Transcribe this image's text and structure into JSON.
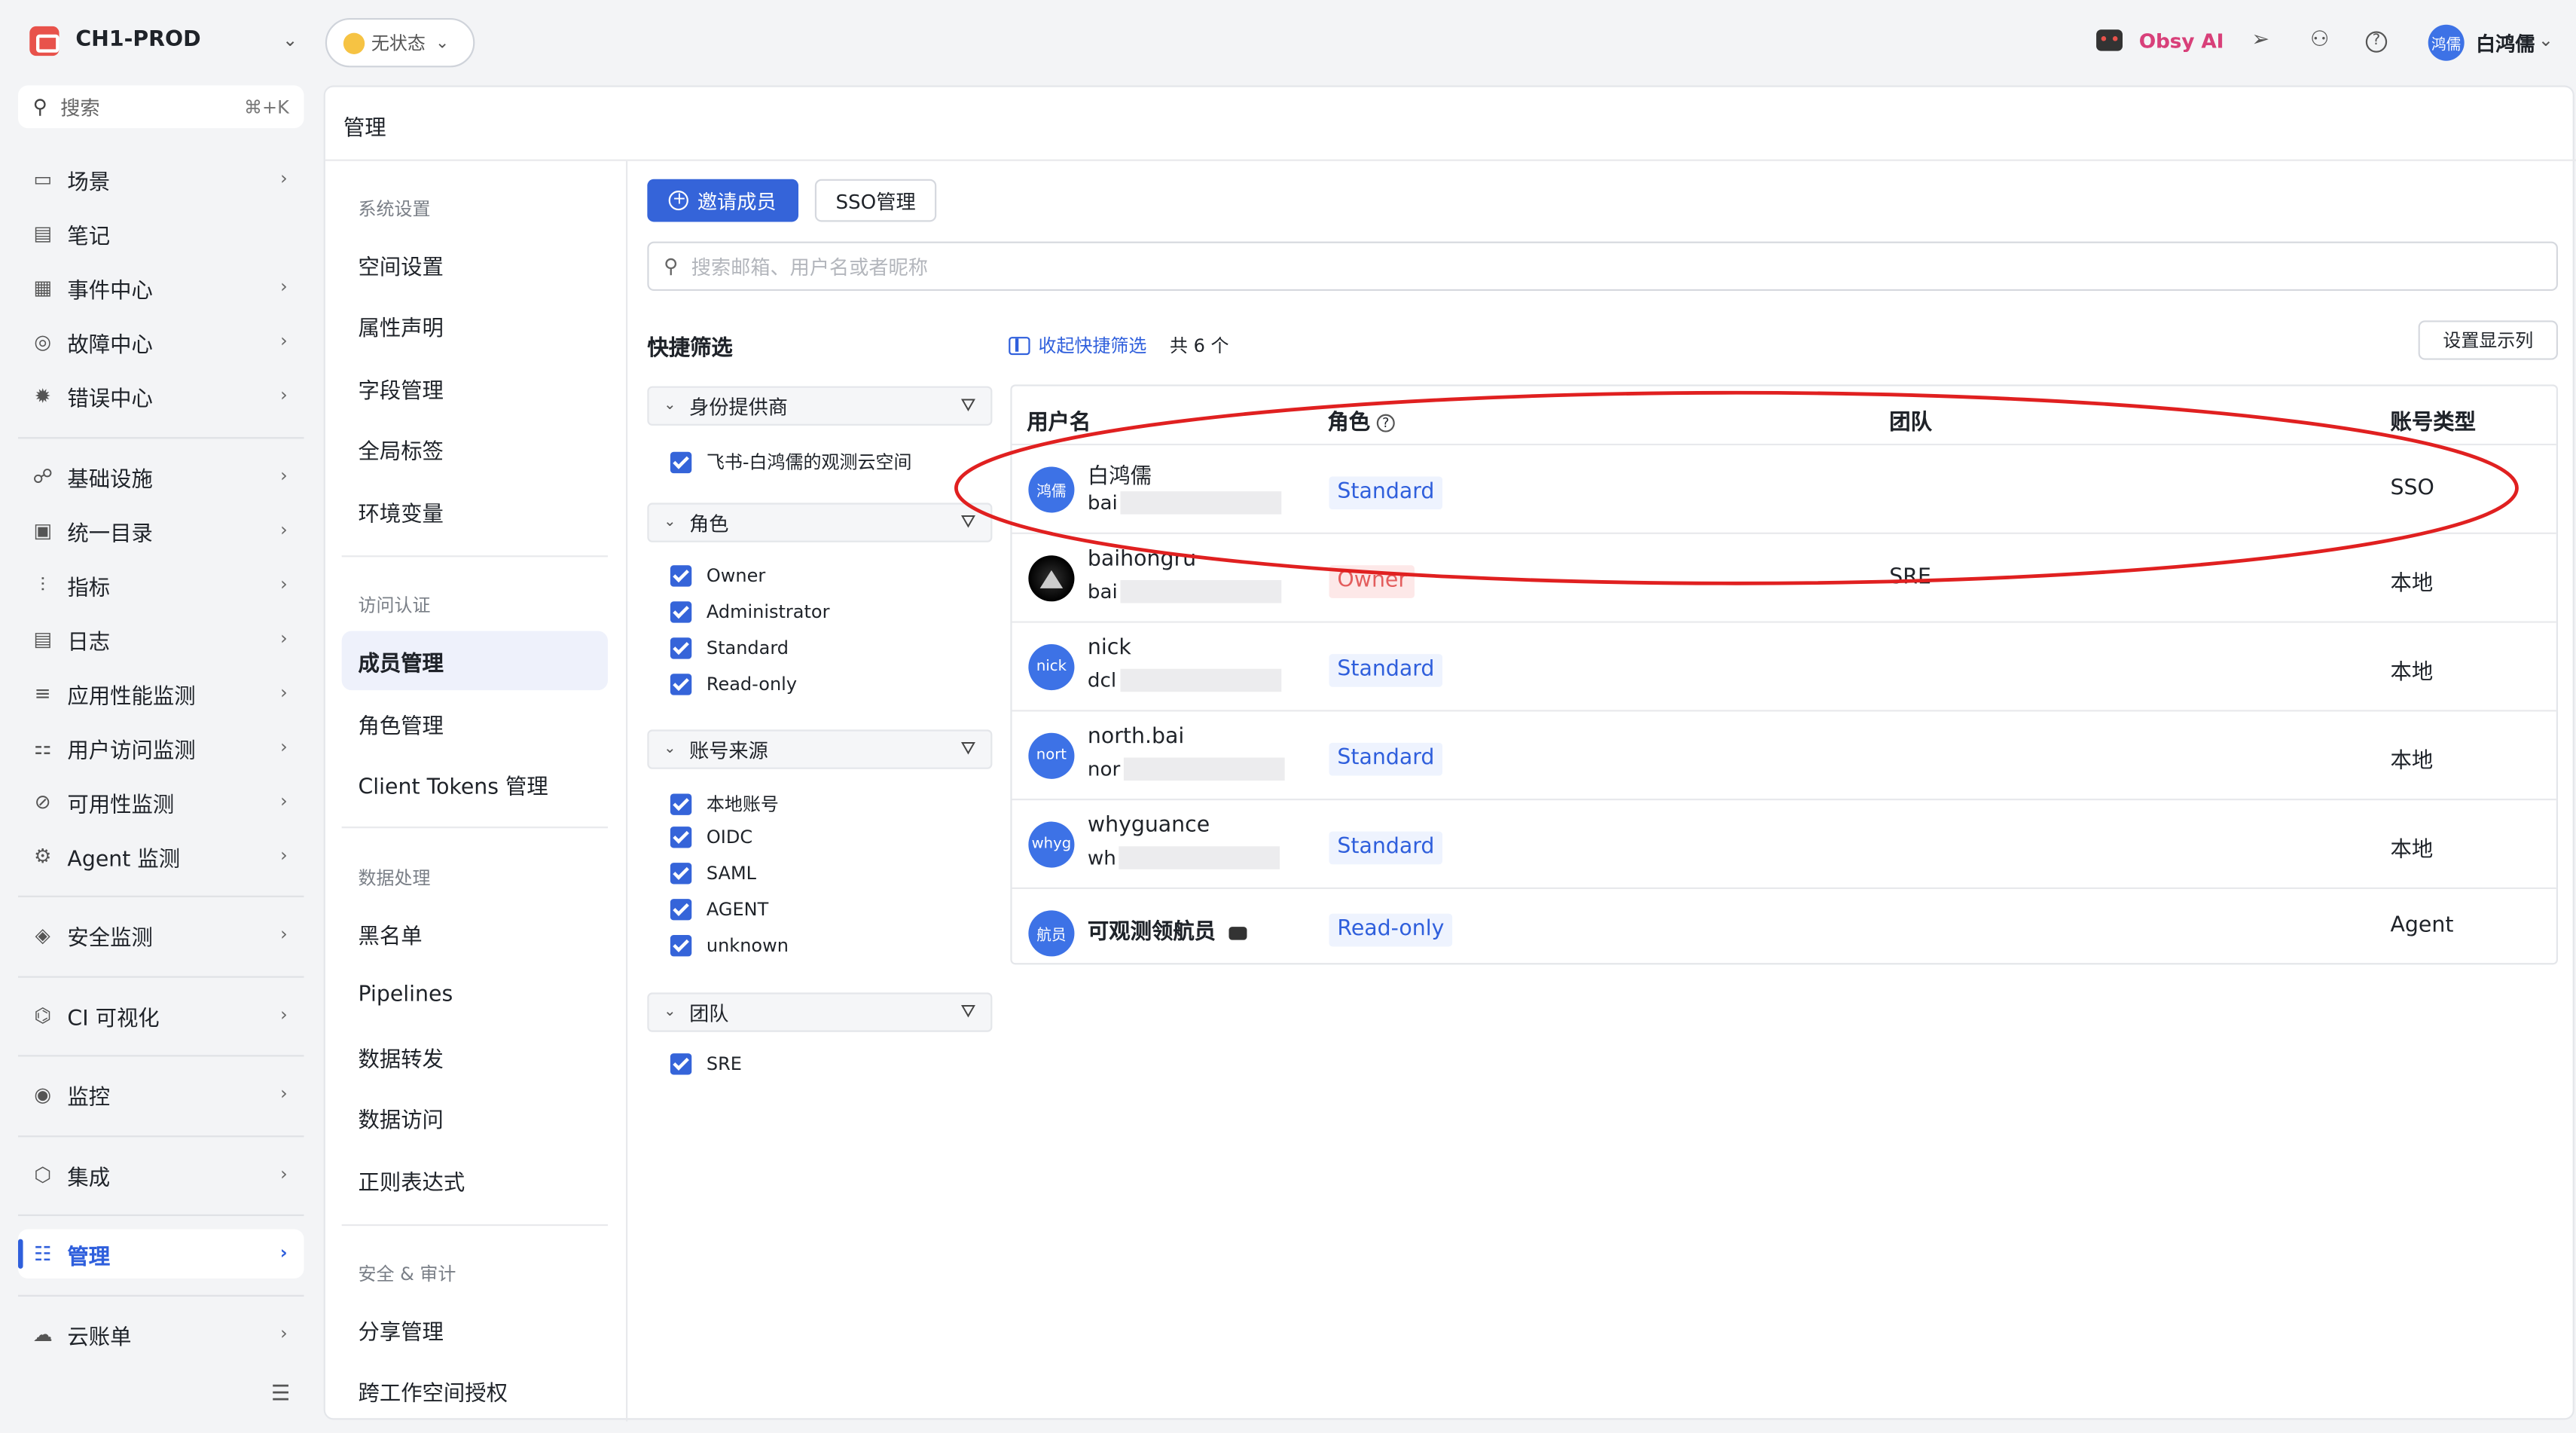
{
  "header": {
    "workspace": "CH1-PROD",
    "status": "无状态",
    "ai_label": "Obsy AI",
    "user_avatar": "鸿儒",
    "user_name": "白鸿儒"
  },
  "sidebar": {
    "search_placeholder": "搜索",
    "search_shortcut": "⌘+K",
    "items": [
      {
        "label": "场景",
        "icon": "monitor-icon"
      },
      {
        "label": "笔记",
        "icon": "note-icon"
      },
      {
        "label": "事件中心",
        "icon": "calendar-icon"
      },
      {
        "label": "故障中心",
        "icon": "fault-icon"
      },
      {
        "label": "错误中心",
        "icon": "bug-icon"
      },
      {
        "label": "基础设施",
        "icon": "infra-icon"
      },
      {
        "label": "统一目录",
        "icon": "catalog-icon"
      },
      {
        "label": "指标",
        "icon": "metric-icon"
      },
      {
        "label": "日志",
        "icon": "log-icon"
      },
      {
        "label": "应用性能监测",
        "icon": "apm-icon"
      },
      {
        "label": "用户访问监测",
        "icon": "rum-icon"
      },
      {
        "label": "可用性监测",
        "icon": "availability-icon"
      },
      {
        "label": "Agent 监测",
        "icon": "agent-icon"
      },
      {
        "label": "安全监测",
        "icon": "shield-icon"
      },
      {
        "label": "CI 可视化",
        "icon": "ci-icon"
      },
      {
        "label": "监控",
        "icon": "monitor-alert-icon"
      },
      {
        "label": "集成",
        "icon": "integration-icon"
      },
      {
        "label": "管理",
        "icon": "settings-sliders-icon"
      },
      {
        "label": "云账单",
        "icon": "cloud-bill-icon"
      }
    ]
  },
  "page": {
    "title": "管理"
  },
  "subnav": {
    "group_system": "系统设置",
    "system_items": [
      "空间设置",
      "属性声明",
      "字段管理",
      "全局标签",
      "环境变量"
    ],
    "group_access": "访问认证",
    "access_items": [
      "成员管理",
      "角色管理",
      "Client Tokens 管理"
    ],
    "group_data": "数据处理",
    "data_items": [
      "黑名单",
      "Pipelines",
      "数据转发",
      "数据访问",
      "正则表达式"
    ],
    "group_security": "安全 & 审计",
    "security_items": [
      "分享管理",
      "跨工作空间授权"
    ]
  },
  "toolbar": {
    "invite_label": "邀请成员",
    "sso_label": "SSO管理",
    "search_placeholder": "搜索邮箱、用户名或者昵称",
    "quick_filter_title": "快捷筛选",
    "collapse_label": "收起快捷筛选",
    "total_label": "共 6 个",
    "columns_label": "设置显示列"
  },
  "filters": {
    "identity": {
      "title": "身份提供商",
      "options": [
        "飞书-白鸿儒的观测云空间"
      ]
    },
    "role": {
      "title": "角色",
      "options": [
        "Owner",
        "Administrator",
        "Standard",
        "Read-only"
      ]
    },
    "source": {
      "title": "账号来源",
      "options": [
        "本地账号",
        "OIDC",
        "SAML",
        "AGENT",
        "unknown"
      ]
    },
    "team": {
      "title": "团队",
      "options": [
        "SRE"
      ]
    }
  },
  "table": {
    "headers": [
      "用户名",
      "角色",
      "团队",
      "账号类型"
    ],
    "rows": [
      {
        "avatar": "鸿儒",
        "name": "白鸿儒",
        "sub": "bai",
        "role": "Standard",
        "team": "",
        "type": "SSO"
      },
      {
        "avatar": "",
        "name": "baihongru",
        "sub": "bai",
        "role": "Owner",
        "team": "SRE",
        "type": "本地"
      },
      {
        "avatar": "nick",
        "name": "nick",
        "sub": "dcl",
        "role": "Standard",
        "team": "",
        "type": "本地"
      },
      {
        "avatar": "nort",
        "name": "north.bai",
        "sub": "nor",
        "role": "Standard",
        "team": "",
        "type": "本地"
      },
      {
        "avatar": "whyg",
        "name": "whyguance",
        "sub": "wh",
        "role": "Standard",
        "team": "",
        "type": "本地"
      },
      {
        "avatar": "航员",
        "name": "可观测领航员",
        "sub": "",
        "role": "Read-only",
        "team": "",
        "type": "Agent"
      }
    ]
  },
  "colors": {
    "accent": "#3564d9",
    "highlight_ellipse": "#e02020"
  }
}
